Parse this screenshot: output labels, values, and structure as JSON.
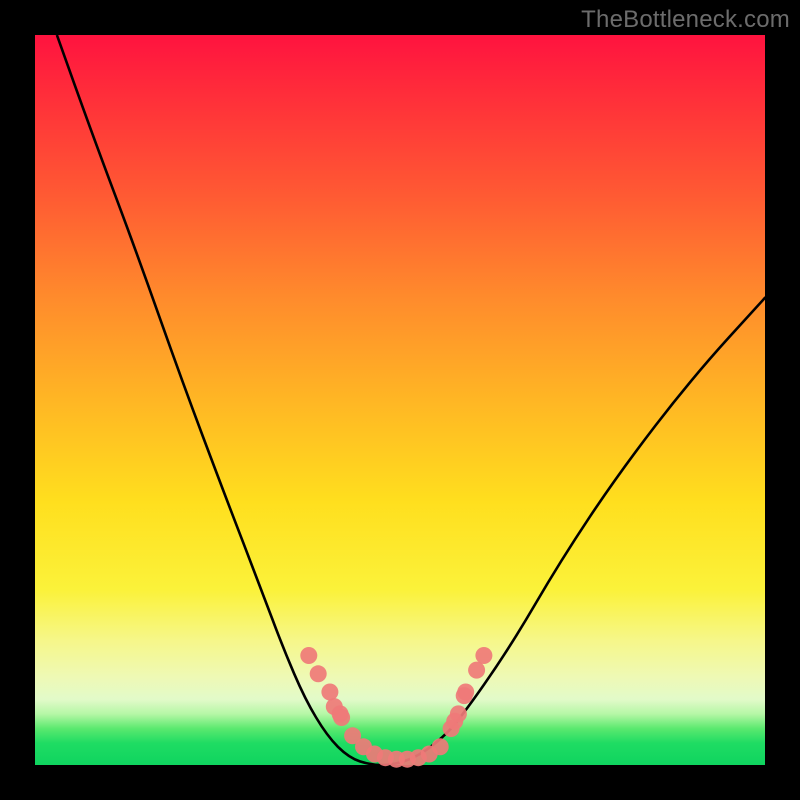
{
  "watermark": "TheBottleneck.com",
  "colors": {
    "gradient_top": "#ff133f",
    "gradient_mid": "#ffdf1e",
    "gradient_bottom": "#0fd45f",
    "frame": "#000000",
    "curve": "#000000",
    "markers": "#ef7a78",
    "watermark_text": "#6c6c6c"
  },
  "chart_data": {
    "type": "line",
    "title": "",
    "xlabel": "",
    "ylabel": "",
    "xlim": [
      0,
      100
    ],
    "ylim": [
      0,
      100
    ],
    "grid": false,
    "legend": false,
    "series": [
      {
        "name": "bottleneck-curve",
        "x": [
          3,
          8,
          14,
          20,
          26,
          31,
          34,
          37,
          40,
          43,
          46,
          49,
          52,
          55,
          58,
          65,
          72,
          80,
          90,
          100
        ],
        "y": [
          100,
          86,
          70,
          53,
          37,
          24,
          16,
          9,
          4,
          1,
          0,
          0,
          1,
          3,
          6,
          16,
          28,
          40,
          53,
          64
        ]
      }
    ],
    "markers": {
      "name": "highlighted-points",
      "x": [
        37.5,
        38.8,
        40.4,
        41.0,
        41.8,
        42.0,
        43.5,
        45.0,
        46.5,
        48.0,
        49.5,
        51.0,
        52.5,
        54.0,
        55.5,
        57.0,
        57.5,
        58.0,
        58.8,
        59.0,
        60.5,
        61.5
      ],
      "y": [
        15.0,
        12.5,
        10.0,
        8.0,
        7.0,
        6.5,
        4.0,
        2.5,
        1.5,
        1.0,
        0.8,
        0.8,
        1.0,
        1.5,
        2.5,
        5.0,
        6.0,
        7.0,
        9.5,
        10.0,
        13.0,
        15.0
      ]
    }
  }
}
